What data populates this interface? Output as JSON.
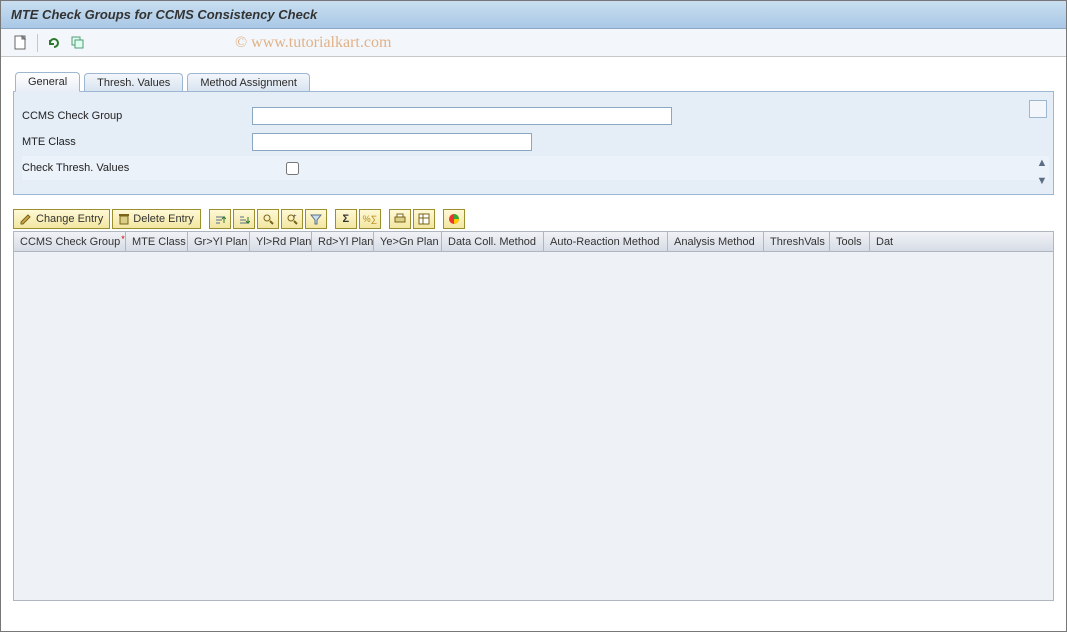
{
  "window": {
    "title": "MTE Check Groups for CCMS Consistency Check"
  },
  "watermark": "© www.tutorialkart.com",
  "main_toolbar": {
    "new_icon": "new-page-icon",
    "refresh_icon": "refresh-icon",
    "copy_icon": "copy-icon"
  },
  "tabs": [
    {
      "label": "General",
      "active": true
    },
    {
      "label": "Thresh. Values",
      "active": false
    },
    {
      "label": "Method Assignment",
      "active": false
    }
  ],
  "form": {
    "ccms_group_label": "CCMS Check Group",
    "ccms_group_value": "",
    "mte_class_label": "MTE Class",
    "mte_class_value": "",
    "check_thresh_label": "Check Thresh. Values",
    "check_thresh_value": false
  },
  "buttons": {
    "change_entry": "Change Entry",
    "delete_entry": "Delete Entry"
  },
  "icon_toolbar": [
    "sort-asc-icon",
    "sort-desc-icon",
    "find-icon",
    "find-next-icon",
    "filter-icon",
    "sum-icon",
    "subtotal-icon",
    "print-icon",
    "layout-icon",
    "chart-icon"
  ],
  "grid_columns": [
    {
      "label": "CCMS Check Group",
      "required": true,
      "width": 112
    },
    {
      "label": "MTE Class",
      "required": false,
      "width": 62
    },
    {
      "label": "Gr>Yl Plan",
      "required": false,
      "width": 62
    },
    {
      "label": "Yl>Rd Plan",
      "required": false,
      "width": 62
    },
    {
      "label": "Rd>Yl Plan",
      "required": false,
      "width": 62
    },
    {
      "label": "Ye>Gn Plan",
      "required": false,
      "width": 68
    },
    {
      "label": "Data Coll. Method",
      "required": false,
      "width": 102
    },
    {
      "label": "Auto-Reaction Method",
      "required": false,
      "width": 124
    },
    {
      "label": "Analysis Method",
      "required": false,
      "width": 96
    },
    {
      "label": "ThreshVals",
      "required": false,
      "width": 66
    },
    {
      "label": "Tools",
      "required": false,
      "width": 40
    },
    {
      "label": "Dat",
      "required": false,
      "width": 28
    }
  ],
  "grid_rows": []
}
